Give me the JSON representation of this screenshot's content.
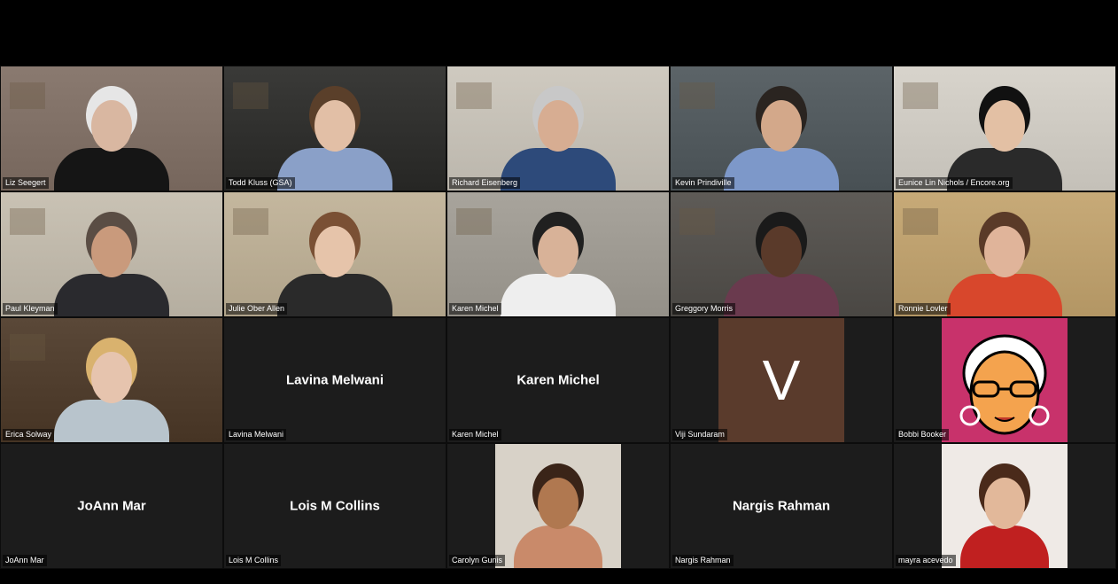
{
  "participants": [
    {
      "name": "Liz Seegert",
      "mode": "video",
      "bg": "#8a7a70",
      "shirt": "#151515",
      "skin": "#d9b7a1",
      "hair": "#e6e6e6"
    },
    {
      "name": "Todd Kluss (GSA)",
      "mode": "video",
      "bg": "#3a3a38",
      "shirt": "#8aa0c8",
      "skin": "#e2bfa6",
      "hair": "#5a3f2a"
    },
    {
      "name": "Richard Eisenberg",
      "mode": "video",
      "bg": "#cfcac0",
      "shirt": "#2d4a7a",
      "skin": "#d7ad92",
      "hair": "#c8c8c8"
    },
    {
      "name": "Kevin Prindiville",
      "mode": "video",
      "bg": "#5c6468",
      "shirt": "#7d98c9",
      "skin": "#d3a88a",
      "hair": "#2a2420"
    },
    {
      "name": "Eunice Lin Nichols / Encore.org",
      "mode": "video",
      "bg": "#d8d4cc",
      "shirt": "#2a2a2a",
      "skin": "#e3c0a4",
      "hair": "#111111"
    },
    {
      "name": "Paul Kleyman",
      "mode": "video",
      "bg": "#c9c2b4",
      "shirt": "#2a2a2e",
      "skin": "#c99a7c",
      "hair": "#5a4d44"
    },
    {
      "name": "Julie Ober Allen",
      "mode": "video",
      "bg": "#c4b79e",
      "shirt": "#2a2a2a",
      "skin": "#e6c4aa",
      "hair": "#7a5034"
    },
    {
      "name": "Karen Michel",
      "mode": "video",
      "bg": "#a8a49c",
      "shirt": "#eeeeee",
      "skin": "#d8b298",
      "hair": "#202020"
    },
    {
      "name": "Greggory Morris",
      "mode": "video",
      "bg": "#5e5b57",
      "shirt": "#6a3a4e",
      "skin": "#5a3a2a",
      "hair": "#1a1a1a"
    },
    {
      "name": "Ronnie Lovler",
      "mode": "video",
      "bg": "#c7aa78",
      "shirt": "#d8472c",
      "skin": "#e0b49a",
      "hair": "#5a3a28"
    },
    {
      "name": "Erica Solway",
      "mode": "video",
      "bg": "#5a4838",
      "shirt": "#b8c4cc",
      "skin": "#e6c4ae",
      "hair": "#d9b26e"
    },
    {
      "name": "Lavina Melwani",
      "mode": "name",
      "display": "Lavina Melwani"
    },
    {
      "name": "Karen Michel",
      "mode": "name",
      "display": "Karen Michel"
    },
    {
      "name": "Viji Sundaram",
      "mode": "letter",
      "letter": "V",
      "avatar_bg": "#5a3b2c"
    },
    {
      "name": "Bobbi Booker",
      "mode": "cartoon",
      "avatar_bg": "#c8326b"
    },
    {
      "name": "JoAnn Mar",
      "mode": "name",
      "display": "JoAnn Mar"
    },
    {
      "name": "Lois M Collins",
      "mode": "name",
      "display": "Lois M Collins"
    },
    {
      "name": "Carolyn Gunis",
      "mode": "photo",
      "bg": "#d8d2c8",
      "shirt": "#c98a6a",
      "skin": "#b07850",
      "hair": "#3a2418"
    },
    {
      "name": "Nargis Rahman",
      "mode": "name",
      "display": "Nargis Rahman"
    },
    {
      "name": "mayra acevedo",
      "mode": "photo",
      "bg": "#efeae6",
      "shirt": "#c02020",
      "skin": "#e2b89a",
      "hair": "#4a2a1a"
    }
  ]
}
